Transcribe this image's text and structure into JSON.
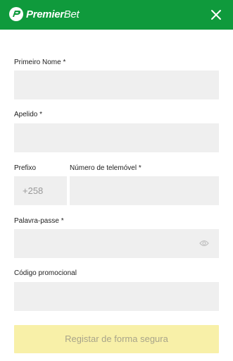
{
  "header": {
    "brand_bold": "Premier",
    "brand_light": "Bet",
    "bg_color": "#0f9a3c",
    "close_icon": "close-icon"
  },
  "form": {
    "first_name": {
      "label": "Primeiro Nome *",
      "value": ""
    },
    "surname": {
      "label": "Apelido *",
      "value": ""
    },
    "prefix": {
      "label": "Prefixo",
      "value": "+258"
    },
    "phone": {
      "label": "Número de telemóvel *",
      "value": ""
    },
    "password": {
      "label": "Palavra-passe *",
      "value": "",
      "toggle_icon": "eye-icon"
    },
    "promo": {
      "label": "Código promocional",
      "value": ""
    }
  },
  "submit": {
    "label": "Registar de forma segura",
    "bg_color": "#f8f0a8"
  }
}
